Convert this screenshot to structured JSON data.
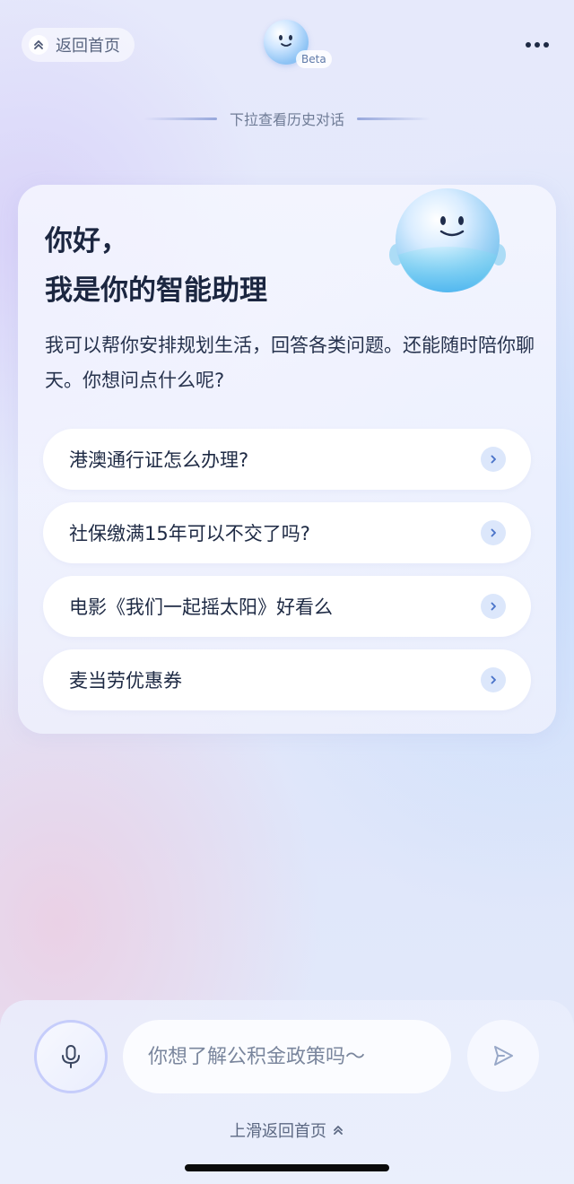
{
  "header": {
    "back_label": "返回首页",
    "logo_badge": "Beta",
    "more_icon": "more-dots-icon"
  },
  "history_hint": "下拉查看历史对话",
  "welcome": {
    "greeting_line1": "你好，",
    "greeting_line2": "我是你的智能助理",
    "intro": "我可以帮你安排规划生活，回答各类问题。还能随时陪你聊天。你想问点什么呢?",
    "suggestions": [
      {
        "label": "港澳通行证怎么办理?"
      },
      {
        "label": "社保缴满15年可以不交了吗?"
      },
      {
        "label": "电影《我们一起摇太阳》好看么"
      },
      {
        "label": "麦当劳优惠券"
      }
    ]
  },
  "input": {
    "placeholder": "你想了解公积金政策吗～",
    "value": ""
  },
  "swipe_hint": "上滑返回首页",
  "colors": {
    "accent": "#c6cdfb",
    "chevron_bg": "#dce7fb",
    "chevron_fg": "#4a74c9",
    "text_primary": "#1b2640",
    "text_secondary": "#6f7c96"
  }
}
